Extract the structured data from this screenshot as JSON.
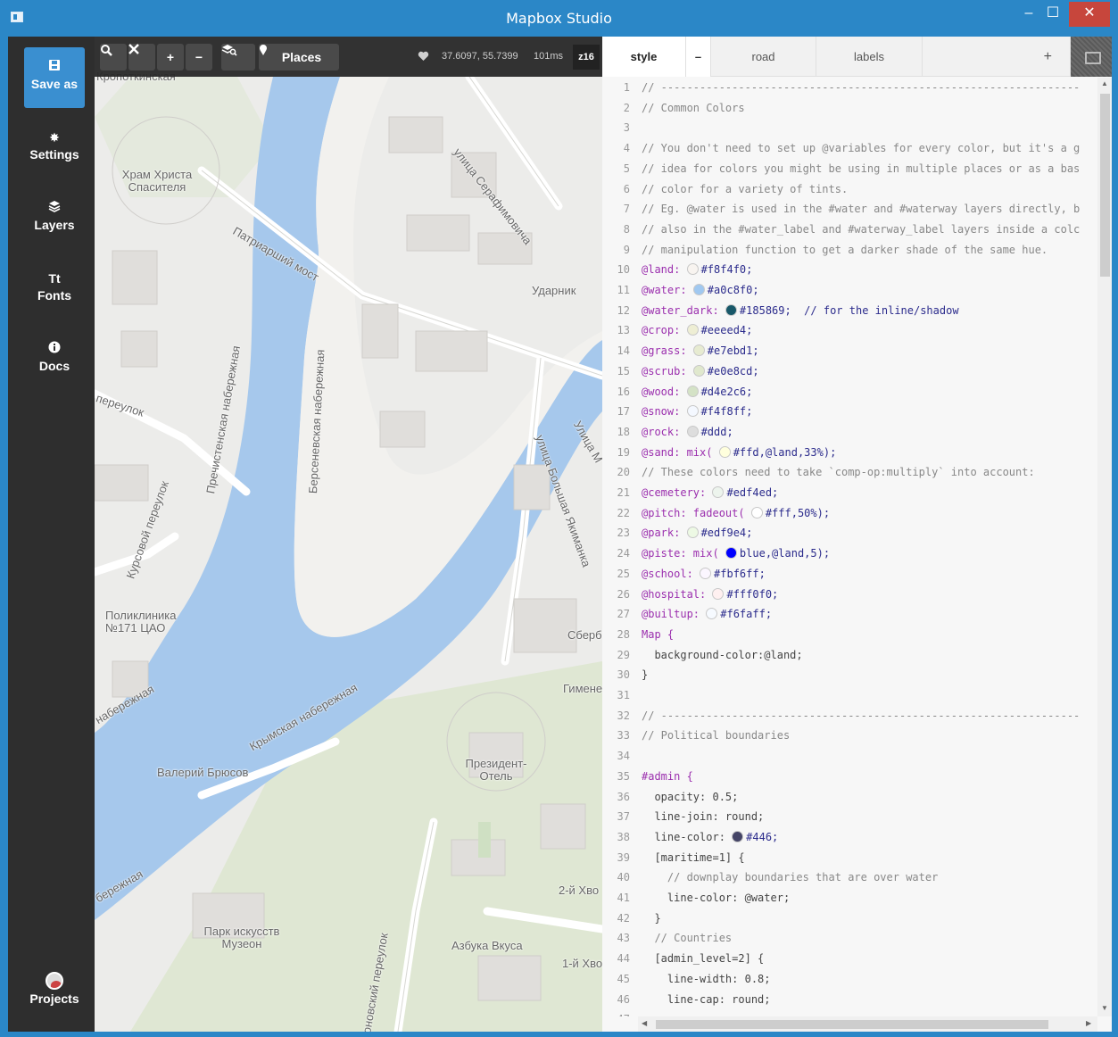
{
  "window": {
    "title": "Mapbox Studio",
    "controls": {
      "minimize": "–",
      "maximize": "☐",
      "close": "✕"
    }
  },
  "sidebar": {
    "items": [
      {
        "label": "Save as",
        "icon": "save-icon"
      },
      {
        "label": "Settings",
        "icon": "gear-icon"
      },
      {
        "label": "Layers",
        "icon": "layers-icon"
      },
      {
        "label": "Fonts",
        "icon": "font-icon",
        "glyph": "Tt"
      },
      {
        "label": "Docs",
        "icon": "info-icon"
      },
      {
        "label": "Projects",
        "icon": "avatar"
      }
    ]
  },
  "map_toolbar": {
    "buttons": [
      "search",
      "fullscreen",
      "zoom-in",
      "zoom-out",
      "layers-inspect"
    ],
    "places_label": "Places",
    "coordinates": "37.6097, 55.7399",
    "render_time": "101ms",
    "zoom": "z16"
  },
  "map_labels": [
    "Кропоткинская",
    "Храм Христа Спасителя",
    "улица Серафимовича",
    "Патриарший мост",
    "Ударник",
    "Берсеневская набережная",
    "Пречистенская набережная",
    "переулок",
    "Курсовой переулок",
    "улица Большая Якиманка",
    "Улица М",
    "Поликлиника №171 ЦАО",
    "набережная",
    "Крымская набережная",
    "Сберб",
    "Гимене",
    "Валерий Брюсов",
    "Президент-Отель",
    "бережная",
    "2-й Хво",
    "Парк искусств Музеон",
    "Азбука Вкуса",
    "1-й Хво",
    "оновский переулок"
  ],
  "editor": {
    "tabs": [
      {
        "label": "style",
        "active": true
      },
      {
        "label": "–",
        "active": false
      },
      {
        "label": "road",
        "active": false
      },
      {
        "label": "labels",
        "active": false
      },
      {
        "label": "+",
        "active": false
      }
    ],
    "lines": [
      {
        "n": "1",
        "text": "// -----------------------------------------------------------------"
      },
      {
        "n": "2",
        "text": "// Common Colors"
      },
      {
        "n": "3",
        "text": ""
      },
      {
        "n": "4",
        "text": "// You don't need to set up @variables for every color, but it's a g"
      },
      {
        "n": "5",
        "text": "// idea for colors you might be using in multiple places or as a bas"
      },
      {
        "n": "6",
        "text": "// color for a variety of tints."
      },
      {
        "n": "7",
        "text": "// Eg. @water is used in the #water and #waterway layers directly, b"
      },
      {
        "n": "8",
        "text": "// also in the #water_label and #waterway_label layers inside a colc"
      },
      {
        "n": "9",
        "text": "// manipulation function to get a darker shade of the same hue."
      },
      {
        "n": "10",
        "text": "@land:  #f8f4f0;"
      },
      {
        "n": "11",
        "text": "@water:  #a0c8f0;"
      },
      {
        "n": "12",
        "text": "@water_dark:  #185869;  // for the inline/shadow"
      },
      {
        "n": "13",
        "text": "@crop:  #eeeed4;"
      },
      {
        "n": "14",
        "text": "@grass:  #e7ebd1;"
      },
      {
        "n": "15",
        "text": "@scrub:  #e0e8cd;"
      },
      {
        "n": "16",
        "text": "@wood:  #d4e2c6;"
      },
      {
        "n": "17",
        "text": "@snow:  #f4f8ff;"
      },
      {
        "n": "18",
        "text": "@rock:  #ddd;"
      },
      {
        "n": "19",
        "text": "@sand: mix( #ffd,@land,33%);"
      },
      {
        "n": "20",
        "text": "// These colors need to take `comp-op:multiply` into account:"
      },
      {
        "n": "21",
        "text": "@cemetery:  #edf4ed;"
      },
      {
        "n": "22",
        "text": "@pitch: fadeout( #fff,50%);"
      },
      {
        "n": "23",
        "text": "@park:  #edf9e4;"
      },
      {
        "n": "24",
        "text": "@piste: mix( blue,@land,5);"
      },
      {
        "n": "25",
        "text": "@school:  #fbf6ff;"
      },
      {
        "n": "26",
        "text": "@hospital:  #fff0f0;"
      },
      {
        "n": "27",
        "text": "@builtup:  #f6faff;"
      },
      {
        "n": "28",
        "text": "Map {"
      },
      {
        "n": "29",
        "text": "  background-color:@land;"
      },
      {
        "n": "30",
        "text": "}"
      },
      {
        "n": "31",
        "text": ""
      },
      {
        "n": "32",
        "text": "// -----------------------------------------------------------------"
      },
      {
        "n": "33",
        "text": "// Political boundaries"
      },
      {
        "n": "34",
        "text": ""
      },
      {
        "n": "35",
        "text": "#admin {"
      },
      {
        "n": "36",
        "text": "  opacity: 0.5;"
      },
      {
        "n": "37",
        "text": "  line-join: round;"
      },
      {
        "n": "38",
        "text": "  line-color:  #446;"
      },
      {
        "n": "39",
        "text": "  [maritime=1] {"
      },
      {
        "n": "40",
        "text": "    // downplay boundaries that are over water"
      },
      {
        "n": "41",
        "text": "    line-color: @water;"
      },
      {
        "n": "42",
        "text": "  }"
      },
      {
        "n": "43",
        "text": "  // Countries"
      },
      {
        "n": "44",
        "text": "  [admin_level=2] {"
      },
      {
        "n": "45",
        "text": "    line-width: 0.8;"
      },
      {
        "n": "46",
        "text": "    line-cap: round;"
      },
      {
        "n": "47",
        "text": ""
      }
    ],
    "swatches": {
      "10": "#f8f4f0",
      "11": "#a0c8f0",
      "12": "#185869",
      "13": "#eeeed4",
      "14": "#e7ebd1",
      "15": "#e0e8cd",
      "16": "#d4e2c6",
      "17": "#f4f8ff",
      "18": "#dddddd",
      "19": "#ffffdd",
      "21": "#edf4ed",
      "22": "#ffffff",
      "23": "#edf9e4",
      "24": "#0000ff",
      "25": "#fbf6ff",
      "26": "#fff0f0",
      "27": "#f6faff",
      "38": "#444466"
    }
  },
  "colors": {
    "titlebar": "#2b87c7",
    "sidebar": "#2e2e2e",
    "accent": "#3a8fd0",
    "water": "#a6c8ec",
    "land": "#ececea",
    "park": "#dbe6cf"
  }
}
